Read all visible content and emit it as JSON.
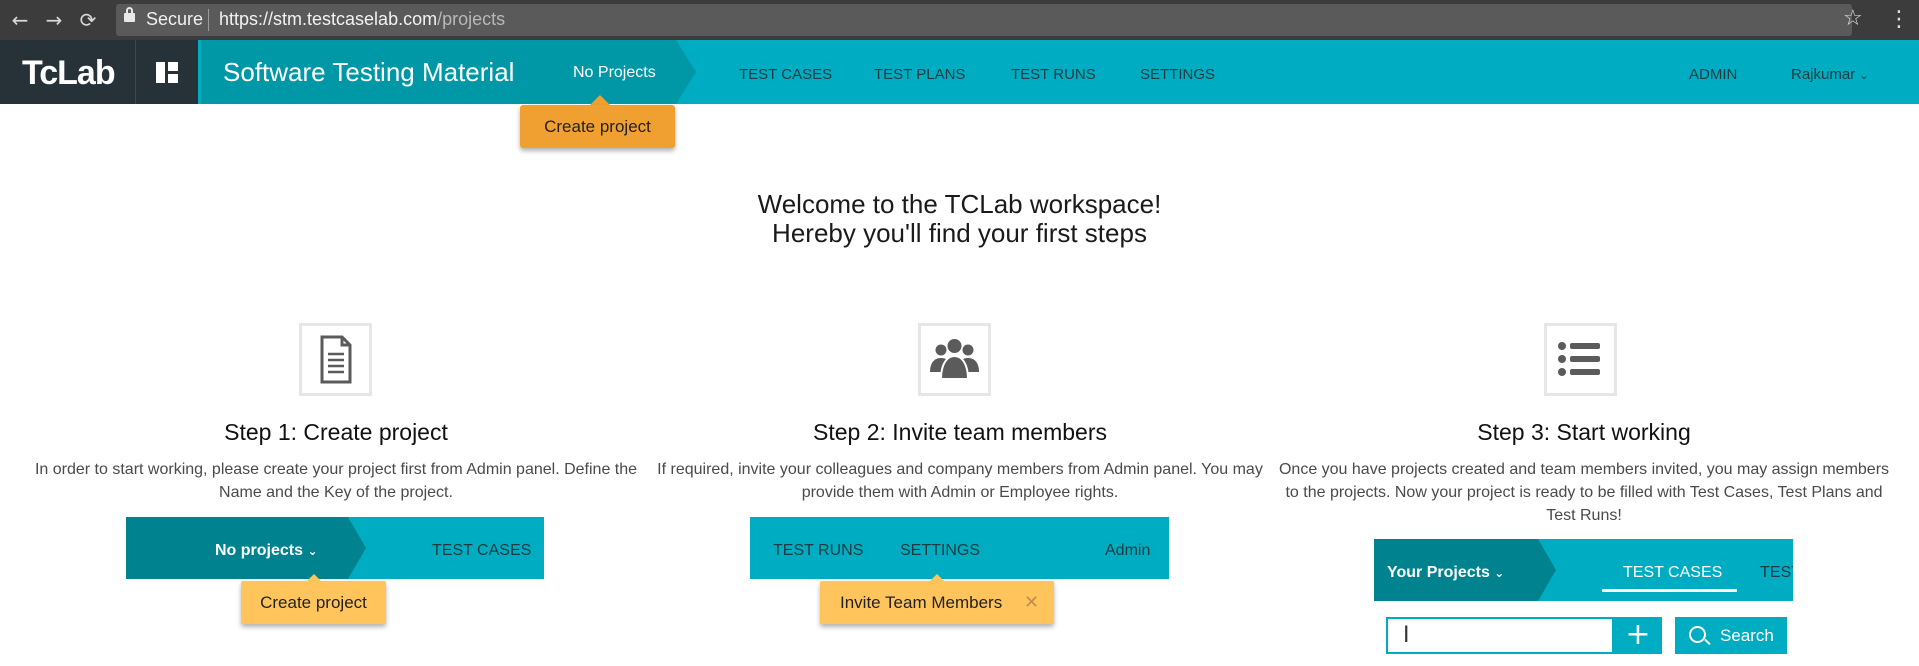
{
  "browser": {
    "secure_label": "Secure",
    "url_base": "https://stm.testcaselab.com",
    "url_path": "/projects"
  },
  "header": {
    "logo": "TcLab",
    "title": "Software Testing Material",
    "project_selector": "No Projects",
    "nav": [
      "TEST CASES",
      "TEST PLANS",
      "TEST RUNS",
      "SETTINGS"
    ],
    "admin": "ADMIN",
    "user": "Rajkumar"
  },
  "popover": {
    "create_project": "Create project"
  },
  "welcome": {
    "line1": "Welcome to the TCLab workspace!",
    "line2": "Hereby you'll find your first steps"
  },
  "steps": [
    {
      "title": "Step 1: Create project",
      "desc": "In order to start working, please create your project first from Admin panel. Define the Name and the Key of the project.",
      "illustration": {
        "selector": "No projects",
        "tab": "TEST CASES",
        "popup": "Create project"
      }
    },
    {
      "title": "Step 2: Invite team members",
      "desc": "If required, invite your colleagues and company members from Admin panel. You may provide them with Admin or Employee rights.",
      "illustration": {
        "tab1": "TEST RUNS",
        "tab2": "SETTINGS",
        "tab3": "Admin",
        "popup": "Invite Team Members"
      }
    },
    {
      "title": "Step 3: Start working",
      "desc": "Once you have projects created and team members invited, you may assign members to the projects. Now your project is ready to be filled with Test Cases, Test Plans and Test Runs!",
      "illustration": {
        "selector": "Your Projects",
        "tab": "TEST CASES",
        "tab_cut": "TEST",
        "search": "Search"
      }
    }
  ]
}
